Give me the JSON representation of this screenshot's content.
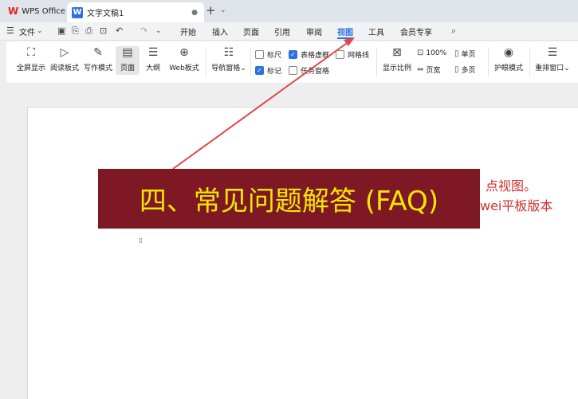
{
  "titlebar": {
    "app_tab": "WPS Office",
    "doc_tab": "文字文稿1"
  },
  "menubar": {
    "file_label": "文件",
    "tabs": [
      "开始",
      "插入",
      "页面",
      "引用",
      "审阅",
      "视图",
      "工具",
      "会员专享"
    ],
    "active_tab": "视图"
  },
  "ribbon": {
    "buttons": [
      "全屏显示",
      "阅读板式",
      "写作模式",
      "页面",
      "大纲",
      "Web板式",
      "导航窗格"
    ],
    "checkboxes": [
      {
        "label": "标尺",
        "checked": false
      },
      {
        "label": "表格虚框",
        "checked": true
      },
      {
        "label": "网格线",
        "checked": false
      },
      {
        "label": "标记",
        "checked": true
      },
      {
        "label": "任务窗格",
        "checked": false
      }
    ],
    "zoom_label": "显示比例",
    "zoom_100": "100%",
    "single_page": "单页",
    "page_width": "页宽",
    "multi_page": "多页",
    "eye_mode": "护眼模式",
    "rearrange": "重排窗口"
  },
  "overlay": {
    "banner_title": "四、常见问题解答 (FAQ)",
    "annotation_line1": "点视图。",
    "annotation_line2": "wei平板版本"
  },
  "colors": {
    "banner_bg": "#7e1825",
    "banner_text": "#f3e600",
    "annotation": "#d13030",
    "accent": "#2f6fe4"
  }
}
